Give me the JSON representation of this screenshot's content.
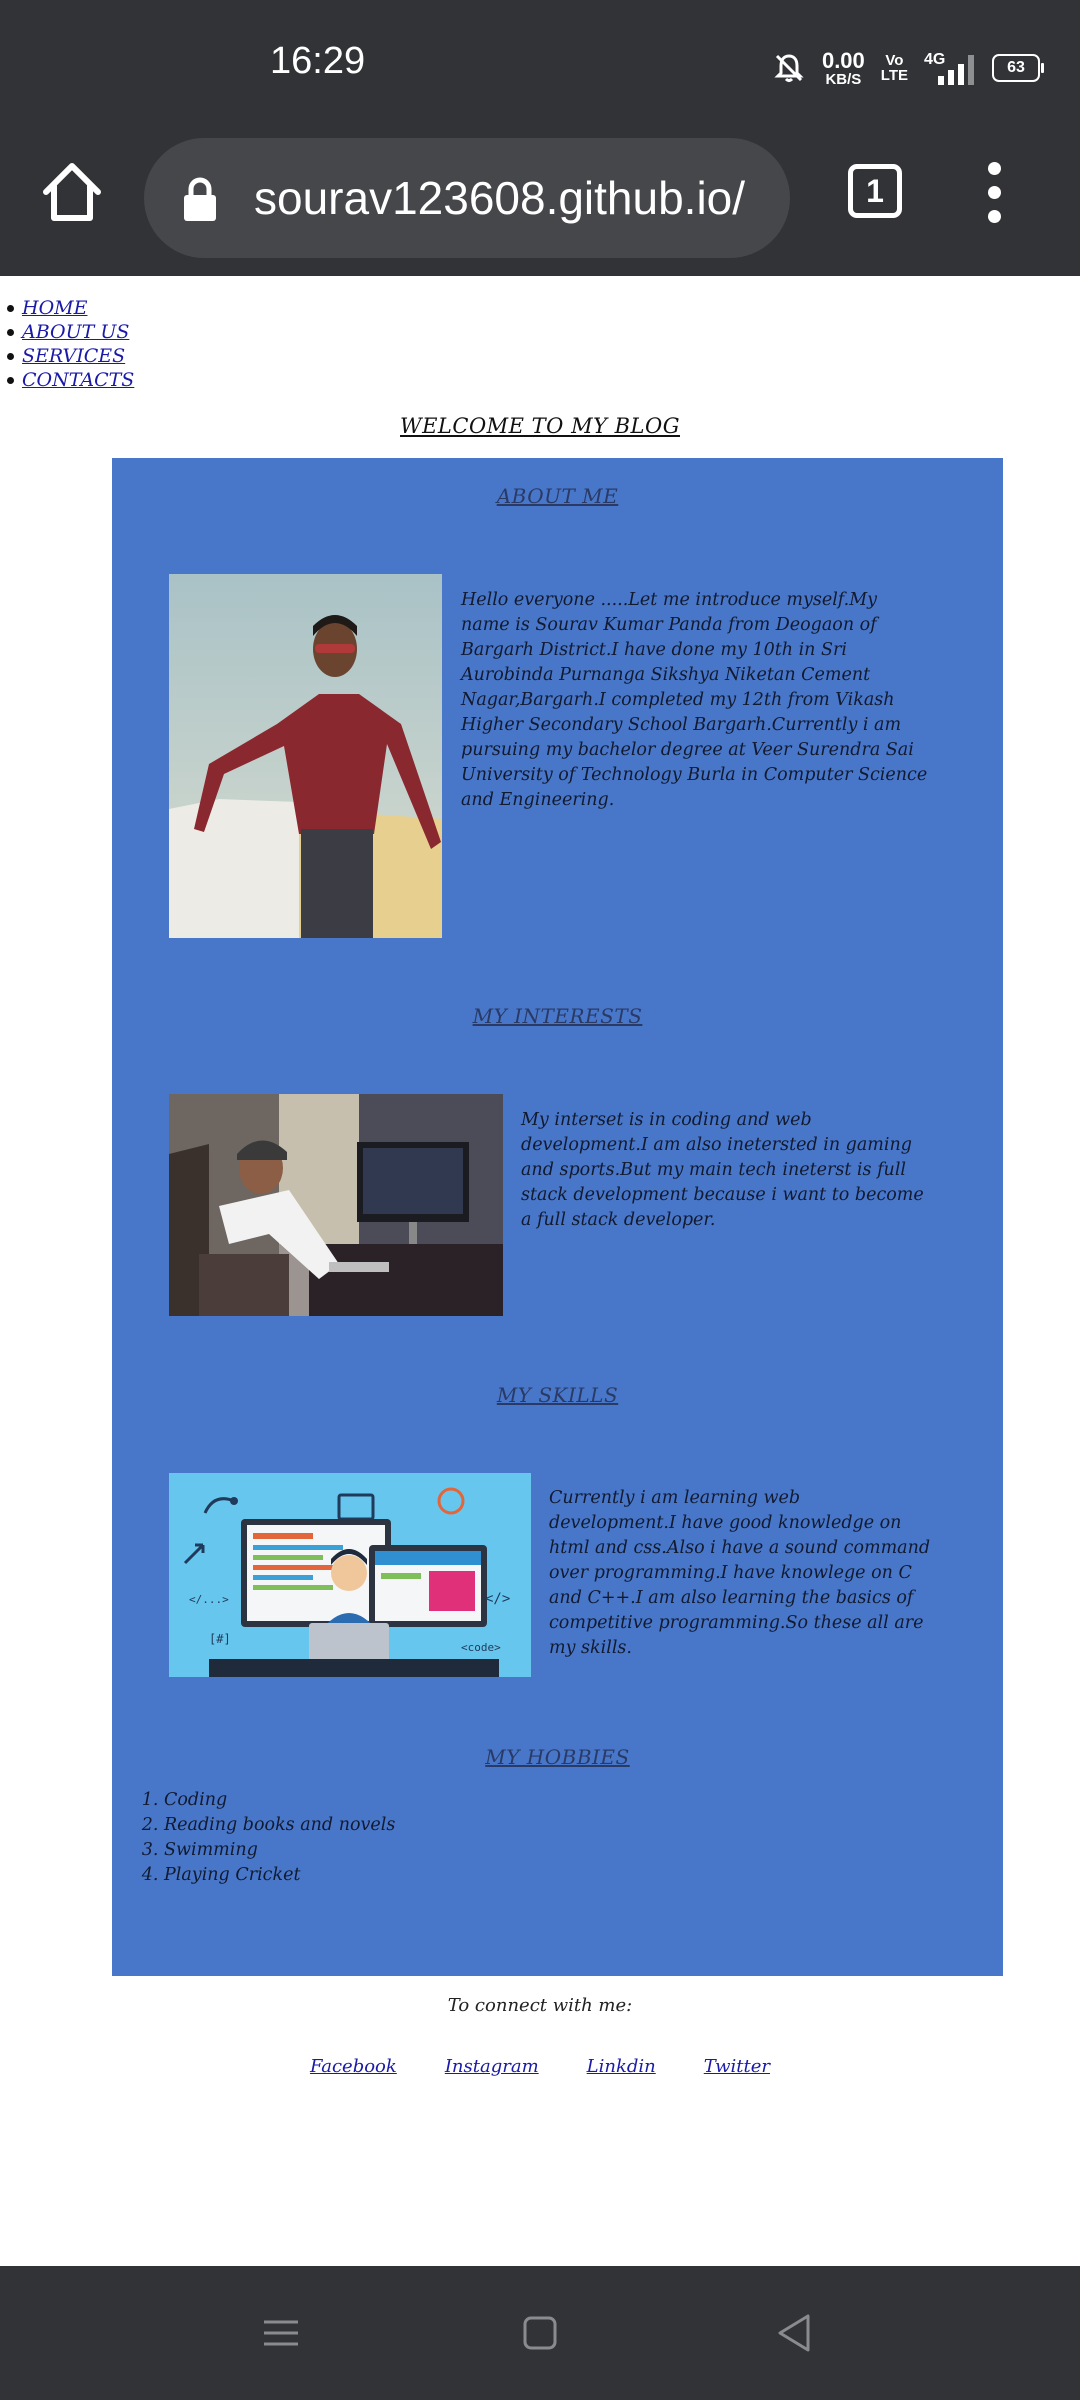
{
  "status": {
    "time": "16:29",
    "net_speed_value": "0.00",
    "net_speed_unit": "KB/S",
    "volte_top": "Vo",
    "volte_bottom": "LTE",
    "network": "4G",
    "battery": "63"
  },
  "browser": {
    "url": "sourav123608.github.io/",
    "tab_count": "1"
  },
  "nav": {
    "items": [
      {
        "label": "HOME"
      },
      {
        "label": "ABOUT US"
      },
      {
        "label": "SERVICES"
      },
      {
        "label": "CONTACTS"
      }
    ]
  },
  "page": {
    "welcome": "WELCOME TO MY BLOG",
    "about": {
      "title": "ABOUT ME",
      "text": "Hello everyone .....Let me introduce myself.My name is Sourav Kumar Panda from Deogaon of Bargarh District.I have done my 10th in Sri Aurobinda Purnanga Sikshya Niketan Cement Nagar,Bargarh.I completed my 12th from Vikash Higher Secondary School Bargarh.Currently i am pursuing my bachelor degree at Veer Surendra Sai University of Technology Burla in Computer Science and Engineering."
    },
    "interests": {
      "title": "MY INTERESTS",
      "text": "My interset is in coding and web development.I am also inetersted in gaming and sports.But my main tech ineterst is full stack development because i want to become a full stack developer."
    },
    "skills": {
      "title": "MY SKILLS",
      "text": "Currently i am learning web development.I have good knowledge on html and css.Also i have a sound command over programming.I have knowlege on C and C++.I am also learning the basics of competitive programming.So these all are my skills."
    },
    "hobbies": {
      "title": "MY HOBBIES",
      "items": [
        "Coding",
        "Reading books and novels",
        "Swimming",
        "Playing Cricket"
      ]
    },
    "connect_label": "To connect with me:",
    "social": [
      {
        "label": "Facebook"
      },
      {
        "label": "Instagram"
      },
      {
        "label": "Linkdin"
      },
      {
        "label": "Twitter"
      }
    ]
  },
  "colors": {
    "panel": "#4877c9",
    "system_bar": "#323336",
    "link": "#1a1aa8"
  }
}
